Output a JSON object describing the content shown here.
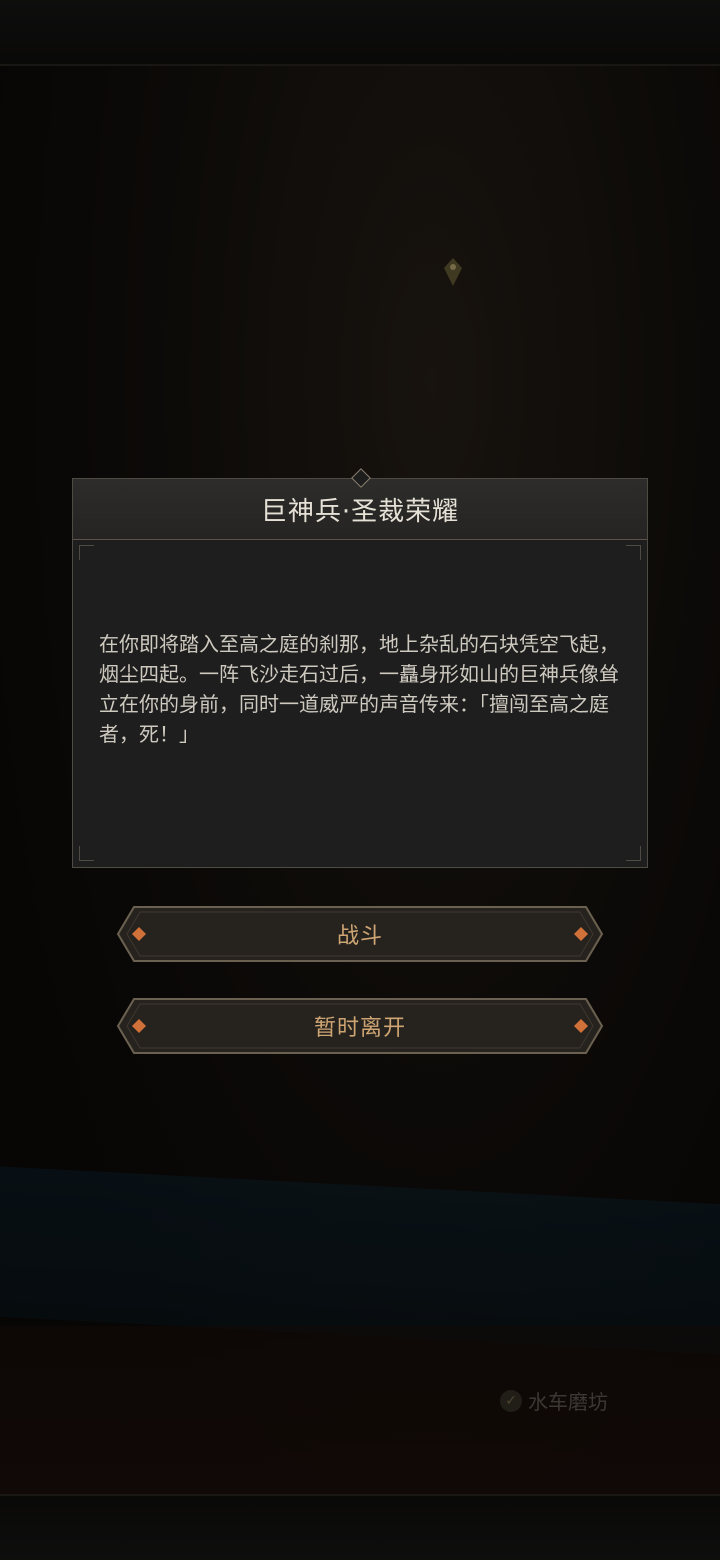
{
  "dialog": {
    "title": "巨神兵·圣裁荣耀",
    "body": "在你即将踏入至高之庭的刹那，地上杂乱的石块凭空飞起，烟尘四起。一阵飞沙走石过后，一矗身形如山的巨神兵像耸立在你的身前，同时一道威严的声音传来：「擅闯至高之庭者，死！」"
  },
  "actions": {
    "fight_label": "战斗",
    "leave_label": "暂时离开"
  },
  "map": {
    "location_label": "水车磨坊",
    "checkmark_icon": "check-icon",
    "marker_icon": "location-pin-icon"
  },
  "colors": {
    "button_text": "#cfa673",
    "dialog_bg": "#1e1e1e",
    "accent_diamond": "#d0713a"
  }
}
